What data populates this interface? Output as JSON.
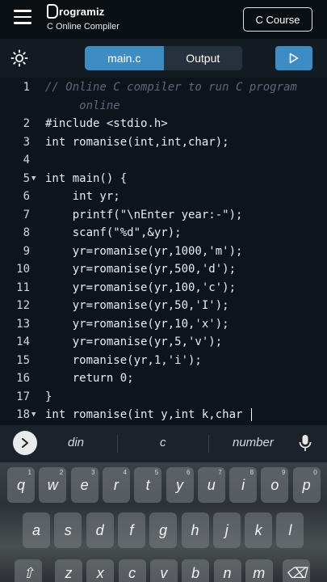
{
  "header": {
    "logo_text": "rogramiz",
    "subtitle": "C Online Compiler",
    "course_button": "C Course"
  },
  "toolbar": {
    "tabs": [
      {
        "label": "main.c",
        "active": true
      },
      {
        "label": "Output",
        "active": false
      }
    ]
  },
  "editor": {
    "lines": [
      {
        "num": "1",
        "fold": "",
        "segments": [
          {
            "t": "// Online C compiler to run C program",
            "c": "comment"
          }
        ]
      },
      {
        "num": "",
        "fold": "",
        "segments": [
          {
            "t": "     online",
            "c": "comment"
          }
        ]
      },
      {
        "num": "2",
        "fold": "",
        "segments": [
          {
            "t": "#include <stdio.h>",
            "c": ""
          }
        ]
      },
      {
        "num": "3",
        "fold": "",
        "segments": [
          {
            "t": "int romanise(int,int,char);",
            "c": ""
          }
        ]
      },
      {
        "num": "4",
        "fold": "",
        "segments": [
          {
            "t": "",
            "c": ""
          }
        ]
      },
      {
        "num": "5",
        "fold": "▼",
        "segments": [
          {
            "t": "int main() {",
            "c": ""
          }
        ]
      },
      {
        "num": "6",
        "fold": "",
        "segments": [
          {
            "t": "    int yr;",
            "c": ""
          }
        ]
      },
      {
        "num": "7",
        "fold": "",
        "segments": [
          {
            "t": "    printf(\"\\nEnter year:-\");",
            "c": ""
          }
        ]
      },
      {
        "num": "8",
        "fold": "",
        "segments": [
          {
            "t": "    scanf(\"%d\",&yr);",
            "c": ""
          }
        ]
      },
      {
        "num": "9",
        "fold": "",
        "segments": [
          {
            "t": "    yr=romanise(yr,1000,'m');",
            "c": ""
          }
        ]
      },
      {
        "num": "10",
        "fold": "",
        "segments": [
          {
            "t": "    yr=romanise(yr,500,'d');",
            "c": ""
          }
        ]
      },
      {
        "num": "11",
        "fold": "",
        "segments": [
          {
            "t": "    yr=romanise(yr,100,'c');",
            "c": ""
          }
        ]
      },
      {
        "num": "12",
        "fold": "",
        "segments": [
          {
            "t": "    yr=romanise(yr,50,'I');",
            "c": ""
          }
        ]
      },
      {
        "num": "13",
        "fold": "",
        "segments": [
          {
            "t": "    yr=romanise(yr,10,'x');",
            "c": ""
          }
        ]
      },
      {
        "num": "14",
        "fold": "",
        "segments": [
          {
            "t": "    yr=romanise(yr,5,'v');",
            "c": ""
          }
        ]
      },
      {
        "num": "15",
        "fold": "",
        "segments": [
          {
            "t": "    romanise(yr,1,'i');",
            "c": ""
          }
        ]
      },
      {
        "num": "16",
        "fold": "",
        "segments": [
          {
            "t": "    return 0;",
            "c": ""
          }
        ]
      },
      {
        "num": "17",
        "fold": "",
        "segments": [
          {
            "t": "}",
            "c": ""
          }
        ]
      },
      {
        "num": "18",
        "fold": "▼",
        "segments": [
          {
            "t": "int romanise(int y,int k,char ",
            "c": ""
          }
        ],
        "cursor": true
      }
    ]
  },
  "suggestions": [
    "din",
    "c",
    "number"
  ],
  "keyboard": {
    "row1": [
      {
        "key": "q",
        "hint": "1"
      },
      {
        "key": "w",
        "hint": "2"
      },
      {
        "key": "e",
        "hint": "3"
      },
      {
        "key": "r",
        "hint": "4"
      },
      {
        "key": "t",
        "hint": "5"
      },
      {
        "key": "y",
        "hint": "6"
      },
      {
        "key": "u",
        "hint": "7"
      },
      {
        "key": "i",
        "hint": "8"
      },
      {
        "key": "o",
        "hint": "9"
      },
      {
        "key": "p",
        "hint": "0"
      }
    ],
    "row2": [
      "a",
      "s",
      "d",
      "f",
      "g",
      "h",
      "j",
      "k",
      "l"
    ],
    "row3": [
      "⇧",
      "z",
      "x",
      "c",
      "v",
      "b",
      "n",
      "m",
      "⌫"
    ]
  },
  "colors": {
    "accent": "#3e8cc4",
    "editor_bg": "#0d141b",
    "comment": "#5c6a78"
  }
}
